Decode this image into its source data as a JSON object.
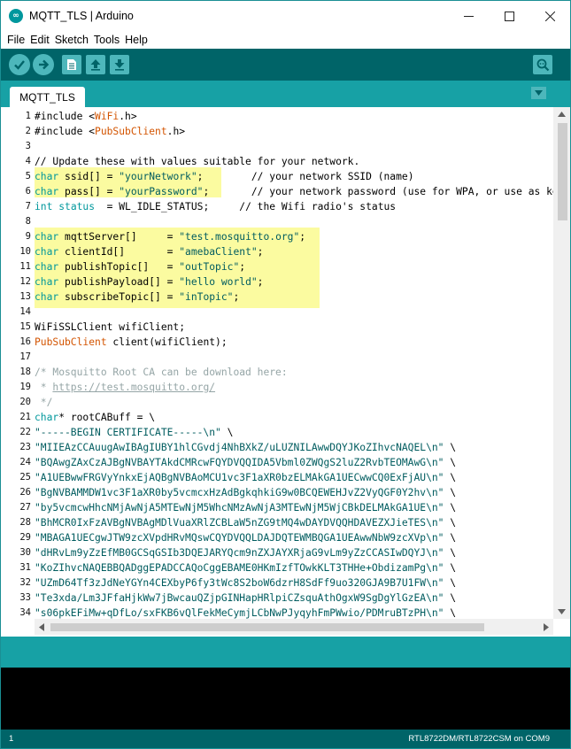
{
  "window": {
    "title": "MQTT_TLS | Arduino",
    "logo_glyph": "∞"
  },
  "menu": [
    "File",
    "Edit",
    "Sketch",
    "Tools",
    "Help"
  ],
  "toolbar": {
    "buttons": [
      "verify-icon",
      "upload-icon",
      "new-icon",
      "open-icon",
      "save-icon",
      "serial-monitor-icon"
    ]
  },
  "tabs": [
    {
      "label": "MQTT_TLS",
      "active": true
    }
  ],
  "editor": {
    "lines": [
      [
        [
          "n",
          "#include <"
        ],
        [
          "c",
          "WiFi"
        ],
        [
          "n",
          ".h>"
        ]
      ],
      [
        [
          "n",
          "#include <"
        ],
        [
          "c",
          "PubSubClient"
        ],
        [
          "n",
          ".h>"
        ]
      ],
      [],
      [
        [
          "n",
          "// Update these with values suitable for your network."
        ]
      ],
      [
        [
          "k",
          "char"
        ],
        [
          "n",
          " ssid[] = "
        ],
        [
          "s",
          "\"yourNetwork\""
        ],
        [
          "n",
          ";        // your network SSID (name)"
        ]
      ],
      [
        [
          "k",
          "char"
        ],
        [
          "n",
          " pass[] = "
        ],
        [
          "s",
          "\"yourPassword\""
        ],
        [
          "n",
          ";       // your network password (use for WPA, or use as key for WEP)"
        ]
      ],
      [
        [
          "k",
          "int"
        ],
        [
          "n",
          " "
        ],
        [
          "k",
          "status"
        ],
        [
          "n",
          "  = WL_IDLE_STATUS;     // the Wifi radio's status"
        ]
      ],
      [],
      [
        [
          "k",
          "char"
        ],
        [
          "n",
          " mqttServer[]     = "
        ],
        [
          "s",
          "\"test.mosquitto.org\""
        ],
        [
          "n",
          ";"
        ]
      ],
      [
        [
          "k",
          "char"
        ],
        [
          "n",
          " clientId[]       = "
        ],
        [
          "s",
          "\"amebaClient\""
        ],
        [
          "n",
          ";"
        ]
      ],
      [
        [
          "k",
          "char"
        ],
        [
          "n",
          " publishTopic[]   = "
        ],
        [
          "s",
          "\"outTopic\""
        ],
        [
          "n",
          ";"
        ]
      ],
      [
        [
          "k",
          "char"
        ],
        [
          "n",
          " publishPayload[] = "
        ],
        [
          "s",
          "\"hello world\""
        ],
        [
          "n",
          ";"
        ]
      ],
      [
        [
          "k",
          "char"
        ],
        [
          "n",
          " subscribeTopic[] = "
        ],
        [
          "s",
          "\"inTopic\""
        ],
        [
          "n",
          ";"
        ]
      ],
      [],
      [
        [
          "n",
          "WiFiSSLClient wifiClient;"
        ]
      ],
      [
        [
          "c",
          "PubSubClient"
        ],
        [
          "n",
          " client(wifiClient);"
        ]
      ],
      [],
      [
        [
          "g",
          "/* Mosquitto Root CA can be download here:"
        ]
      ],
      [
        [
          "g",
          " * "
        ],
        [
          "u",
          "https://test.mosquitto.org/"
        ]
      ],
      [
        [
          "g",
          " */"
        ]
      ],
      [
        [
          "k",
          "char"
        ],
        [
          "n",
          "* rootCABuff = \\"
        ]
      ],
      [
        [
          "s",
          "\"-----BEGIN CERTIFICATE-----\\n\""
        ],
        [
          "n",
          " \\"
        ]
      ],
      [
        [
          "s",
          "\"MIIEAzCCAuugAwIBAgIUBY1hlCGvdj4NhBXkZ/uLUZNILAwwDQYJKoZIhvcNAQEL\\n\""
        ],
        [
          "n",
          " \\"
        ]
      ],
      [
        [
          "s",
          "\"BQAwgZAxCzAJBgNVBAYTAkdCMRcwFQYDVQQIDA5Vbml0ZWQgS2luZ2RvbTEOMAwG\\n\""
        ],
        [
          "n",
          " \\"
        ]
      ],
      [
        [
          "s",
          "\"A1UEBwwFRGVyYnkxEjAQBgNVBAoMCU1vc3F1aXR0bzELMAkGA1UECwwCQ0ExFjAU\\n\""
        ],
        [
          "n",
          " \\"
        ]
      ],
      [
        [
          "s",
          "\"BgNVBAMMDW1vc3F1aXR0by5vcmcxHzAdBgkqhkiG9w0BCQEWEHJvZ2VyQGF0Y2hv\\n\""
        ],
        [
          "n",
          " \\"
        ]
      ],
      [
        [
          "s",
          "\"by5vcmcwHhcNMjAwNjA5MTEwNjM5WhcNMzAwNjA3MTEwNjM5WjCBkDELMAkGA1UE\\n\""
        ],
        [
          "n",
          " \\"
        ]
      ],
      [
        [
          "s",
          "\"BhMCR0IxFzAVBgNVBAgMDlVuaXRlZCBLaW5nZG9tMQ4wDAYDVQQHDAVEZXJieTES\\n\""
        ],
        [
          "n",
          " \\"
        ]
      ],
      [
        [
          "s",
          "\"MBAGA1UECgwJTW9zcXVpdHRvMQswCQYDVQQLDAJDQTEWMBQGA1UEAwwNbW9zcXVp\\n\""
        ],
        [
          "n",
          " \\"
        ]
      ],
      [
        [
          "s",
          "\"dHRvLm9yZzEfMB0GCSqGSIb3DQEJARYQcm9nZXJAYXRjaG9vLm9yZzCCASIwDQYJ\\n\""
        ],
        [
          "n",
          " \\"
        ]
      ],
      [
        [
          "s",
          "\"KoZIhvcNAQEBBQADggEPADCCAQoCggEBAME0HKmIzfTOwkKLT3THHe+ObdizamPg\\n\""
        ],
        [
          "n",
          " \\"
        ]
      ],
      [
        [
          "s",
          "\"UZmD64Tf3zJdNeYGYn4CEXbyP6fy3tWc8S2boW6dzrH8SdFf9uo320GJA9B7U1FW\\n\""
        ],
        [
          "n",
          " \\"
        ]
      ],
      [
        [
          "s",
          "\"Te3xda/Lm3JFfaHjkWw7jBwcauQZjpGINHapHRlpiCZsquAthOgxW9SgDgYlGzEA\\n\""
        ],
        [
          "n",
          " \\"
        ]
      ],
      [
        [
          "s",
          "\"s06pkEFiMw+qDfLo/sxFKB6vQlFekMeCymjLCbNwPJyqyhFmPWwio/PDMruBTzPH\\n\""
        ],
        [
          "n",
          " \\"
        ]
      ]
    ]
  },
  "status": {
    "line": "1",
    "board": "RTL8722DM/RTL8722CSM on COM9"
  }
}
